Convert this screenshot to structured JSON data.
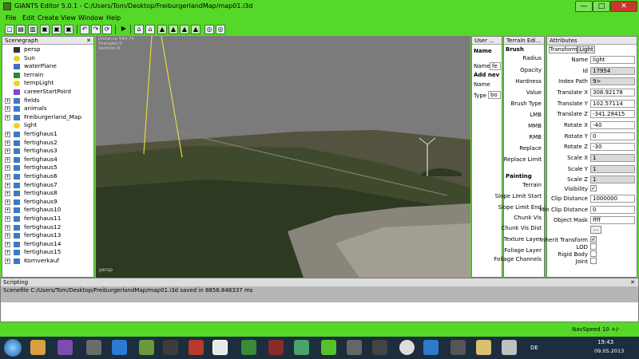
{
  "window": {
    "title": "GIANTS Editor 5.0.1 - C:/Users/Tom/Desktop/FreiburgerlandMap/map01.i3d",
    "min": "—",
    "max": "□",
    "close": "✕"
  },
  "menu": [
    "File",
    "Edit",
    "Create",
    "View",
    "Window",
    "Help"
  ],
  "scenegraph": {
    "title": "Scenegraph",
    "close": "✕",
    "items": [
      {
        "label": "persp",
        "icon": "camera-icon",
        "expand": ""
      },
      {
        "label": "Sun",
        "icon": "light-bulb-icon",
        "expand": ""
      },
      {
        "label": "waterPlane",
        "icon": "shape-icon",
        "expand": ""
      },
      {
        "label": "terrain",
        "icon": "terrain-icon",
        "expand": ""
      },
      {
        "label": "tempLight",
        "icon": "light-bulb-icon",
        "expand": ""
      },
      {
        "label": "careerStartPoint",
        "icon": "transform-icon",
        "expand": ""
      },
      {
        "label": "fields",
        "icon": "transform-group-icon",
        "expand": "+"
      },
      {
        "label": "animals",
        "icon": "transform-group-icon",
        "expand": "+"
      },
      {
        "label": "Freiburgerland_Map",
        "icon": "transform-group-icon",
        "expand": "+"
      },
      {
        "label": "light",
        "icon": "light-bulb-icon",
        "expand": ""
      },
      {
        "label": "fertighaus1",
        "icon": "transform-group-icon",
        "expand": "+"
      },
      {
        "label": "fertighaus2",
        "icon": "transform-group-icon",
        "expand": "+"
      },
      {
        "label": "fertighaus3",
        "icon": "transform-group-icon",
        "expand": "+"
      },
      {
        "label": "fertighaus4",
        "icon": "transform-group-icon",
        "expand": "+"
      },
      {
        "label": "fertighaus5",
        "icon": "transform-group-icon",
        "expand": "+"
      },
      {
        "label": "fertighaus6",
        "icon": "transform-group-icon",
        "expand": "+"
      },
      {
        "label": "fertighaus7",
        "icon": "transform-group-icon",
        "expand": "+"
      },
      {
        "label": "fertighaus8",
        "icon": "transform-group-icon",
        "expand": "+"
      },
      {
        "label": "fertighaus9",
        "icon": "transform-group-icon",
        "expand": "+"
      },
      {
        "label": "fertighaus10",
        "icon": "transform-group-icon",
        "expand": "+"
      },
      {
        "label": "fertighaus11",
        "icon": "transform-group-icon",
        "expand": "+"
      },
      {
        "label": "fertighaus12",
        "icon": "transform-group-icon",
        "expand": "+"
      },
      {
        "label": "fertighaus13",
        "icon": "transform-group-icon",
        "expand": "+"
      },
      {
        "label": "fertighaus14",
        "icon": "transform-group-icon",
        "expand": "+"
      },
      {
        "label": "fertighaus15",
        "icon": "transform-group-icon",
        "expand": "+"
      },
      {
        "label": "Kornverkauf",
        "icon": "transform-group-icon",
        "expand": "+"
      }
    ]
  },
  "viewport": {
    "stats": [
      "Distance 544.74",
      "Triangles 0",
      "Vertices 0"
    ],
    "camera_label": "persp"
  },
  "user_attributes": {
    "title": "User ...",
    "name_heading": "Name",
    "name_label": "Name",
    "name_value": "fe",
    "add_new": "Add nev",
    "add_name_label": "Name",
    "type_label": "Type",
    "type_value": "bo"
  },
  "terrain_editor": {
    "title": "Terrain Edi...",
    "brush_heading": "Brush",
    "brush_items": [
      "Radius",
      "Opacity",
      "Hardness",
      "Value",
      "Brush Type",
      "LMB",
      "MMB",
      "RMB",
      "Replace",
      "Replace Limit"
    ],
    "painting_heading": "Painting",
    "painting_items": [
      "Terrain",
      "Slope Limit Start",
      "Slope Limit End",
      "Chunk Vis",
      "Chunk Vis Dist",
      "Texture Layer",
      "Foliage Layer",
      "Foliage Channels"
    ]
  },
  "attributes": {
    "title": "Attributes",
    "tabs": [
      "Transform",
      "Light"
    ],
    "name_label": "Name",
    "name_value": "light",
    "id_label": "Id",
    "id_value": "17954",
    "index_label": "Index Path",
    "index_value": "9>",
    "tx_label": "Translate X",
    "tx_value": "308.92178",
    "ty_label": "Translate Y",
    "ty_value": "102.57114",
    "tz_label": "Translate Z",
    "tz_value": "-341.28415",
    "rx_label": "Rotate X",
    "rx_value": "-40",
    "ry_label": "Rotate Y",
    "ry_value": "0",
    "rz_label": "Rotate Z",
    "rz_value": "-30",
    "sx_label": "Scale X",
    "sx_value": "1",
    "sy_label": "Scale Y",
    "sy_value": "1",
    "sz_label": "Scale Z",
    "sz_value": "1",
    "visibility_label": "Visibility",
    "visibility_value": "✓",
    "clip_label": "Clip Distance",
    "clip_value": "1000000",
    "minclip_label": "Min Clip Distance",
    "minclip_value": "0",
    "mask_label": "Object Mask",
    "mask_value": "ffff",
    "ellipsis": "...",
    "inherit_label": "Inherit Transform",
    "inherit_value": "✓",
    "lod_label": "LOD",
    "rigid_label": "Rigid Body",
    "joint_label": "Joint"
  },
  "scripting": {
    "title": "Scripting",
    "close": "✕",
    "log": "Scenefile C:/Users/Tom/Desktop/FreiburgerlandMap/map01.i3d saved in 8856.848337 ms"
  },
  "status": {
    "navspeed": "NavSpeed 10 +/-"
  },
  "taskbar": {
    "lang": "DE",
    "time": "19:43",
    "date": "09.05.2013"
  }
}
